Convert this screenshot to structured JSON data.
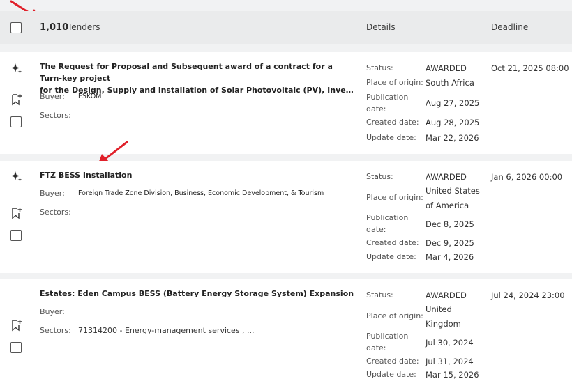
{
  "header": {
    "count": "1,010",
    "count_label": "Tenders",
    "details": "Details",
    "deadline": "Deadline"
  },
  "labels": {
    "buyer": "Buyer:",
    "sectors": "Sectors:",
    "status": "Status:",
    "place": "Place of origin:",
    "publication_line1": "Publication",
    "publication_line2": "date:",
    "created": "Created date:",
    "updated": "Update date:"
  },
  "tenders": [
    {
      "title_line1": "The Request for Proposal and Subsequent award of a contract for a Turn-key project",
      "title_line2": "for the Design, Supply and installation of Solar Photovoltaic (PV), Inverter and Batte...",
      "buyer": "ESKOM",
      "sectors": "",
      "status": "AWARDED",
      "place_line1": "South Africa",
      "place_line2": "",
      "publication": "Aug 27, 2025",
      "created": "Aug 28, 2025",
      "updated": "Mar 22, 2026",
      "deadline": "Oct 21, 2025 08:00"
    },
    {
      "title_line1": "FTZ BESS Installation",
      "title_line2": "",
      "buyer": "Foreign Trade Zone Division, Business, Economic Development, & Tourism",
      "sectors": "",
      "status": "AWARDED",
      "place_line1": "United States",
      "place_line2": "of America",
      "publication": "Dec 8, 2025",
      "created": "Dec 9, 2025",
      "updated": "Mar 4, 2026",
      "deadline": "Jan 6, 2026 00:00"
    },
    {
      "title_line1": "Estates: Eden Campus BESS (Battery Energy Storage System) Expansion",
      "title_line2": "",
      "buyer": "",
      "sectors": "71314200 - Energy-management services , ...",
      "status": "AWARDED",
      "place_line1": "United",
      "place_line2": "Kingdom",
      "publication": "Jul 30, 2024",
      "created": "Jul 31, 2024",
      "updated": "Mar 15, 2026",
      "deadline": "Jul 24, 2024 23:00"
    }
  ],
  "colors": {
    "annotation_arrow": "#e0202a",
    "card": "#ffffff",
    "header": "#eaebec",
    "background": "#f1f2f3"
  },
  "icons": {
    "ai": "sparkle-icon",
    "bookmark": "bookmark-add-icon"
  }
}
